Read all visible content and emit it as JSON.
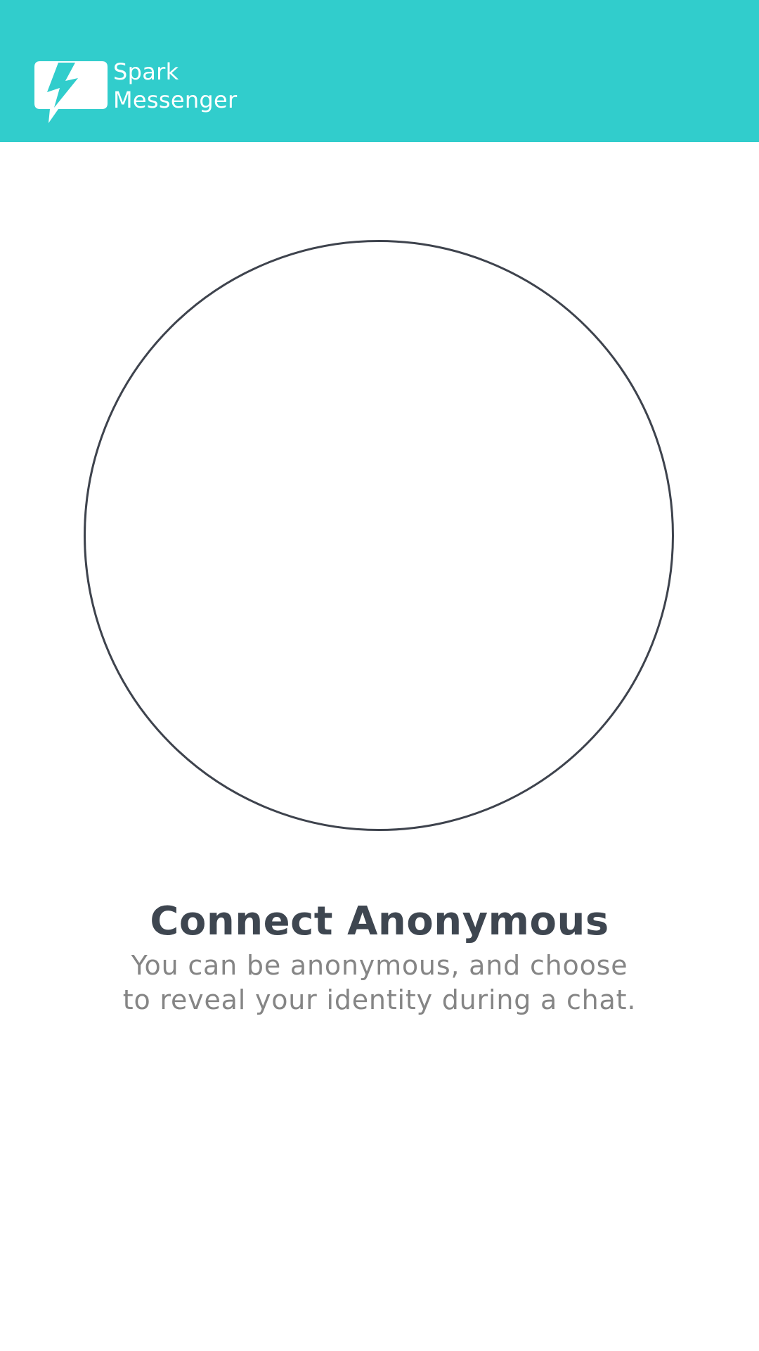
{
  "app": {
    "name_line1": "Spark",
    "name_line2": "Messenger",
    "icon": "lightning-chat-bubble-icon",
    "header_color": "#31cdcc"
  },
  "main": {
    "avatar_icon": "empty-circle-placeholder",
    "title": "Connect Anonymous",
    "description_line1": "You can be anonymous, and choose",
    "description_line2": "to reveal your identity during a chat."
  },
  "colors": {
    "title": "#3e4650",
    "description": "#858585",
    "circle_outline": "#3e434d"
  }
}
